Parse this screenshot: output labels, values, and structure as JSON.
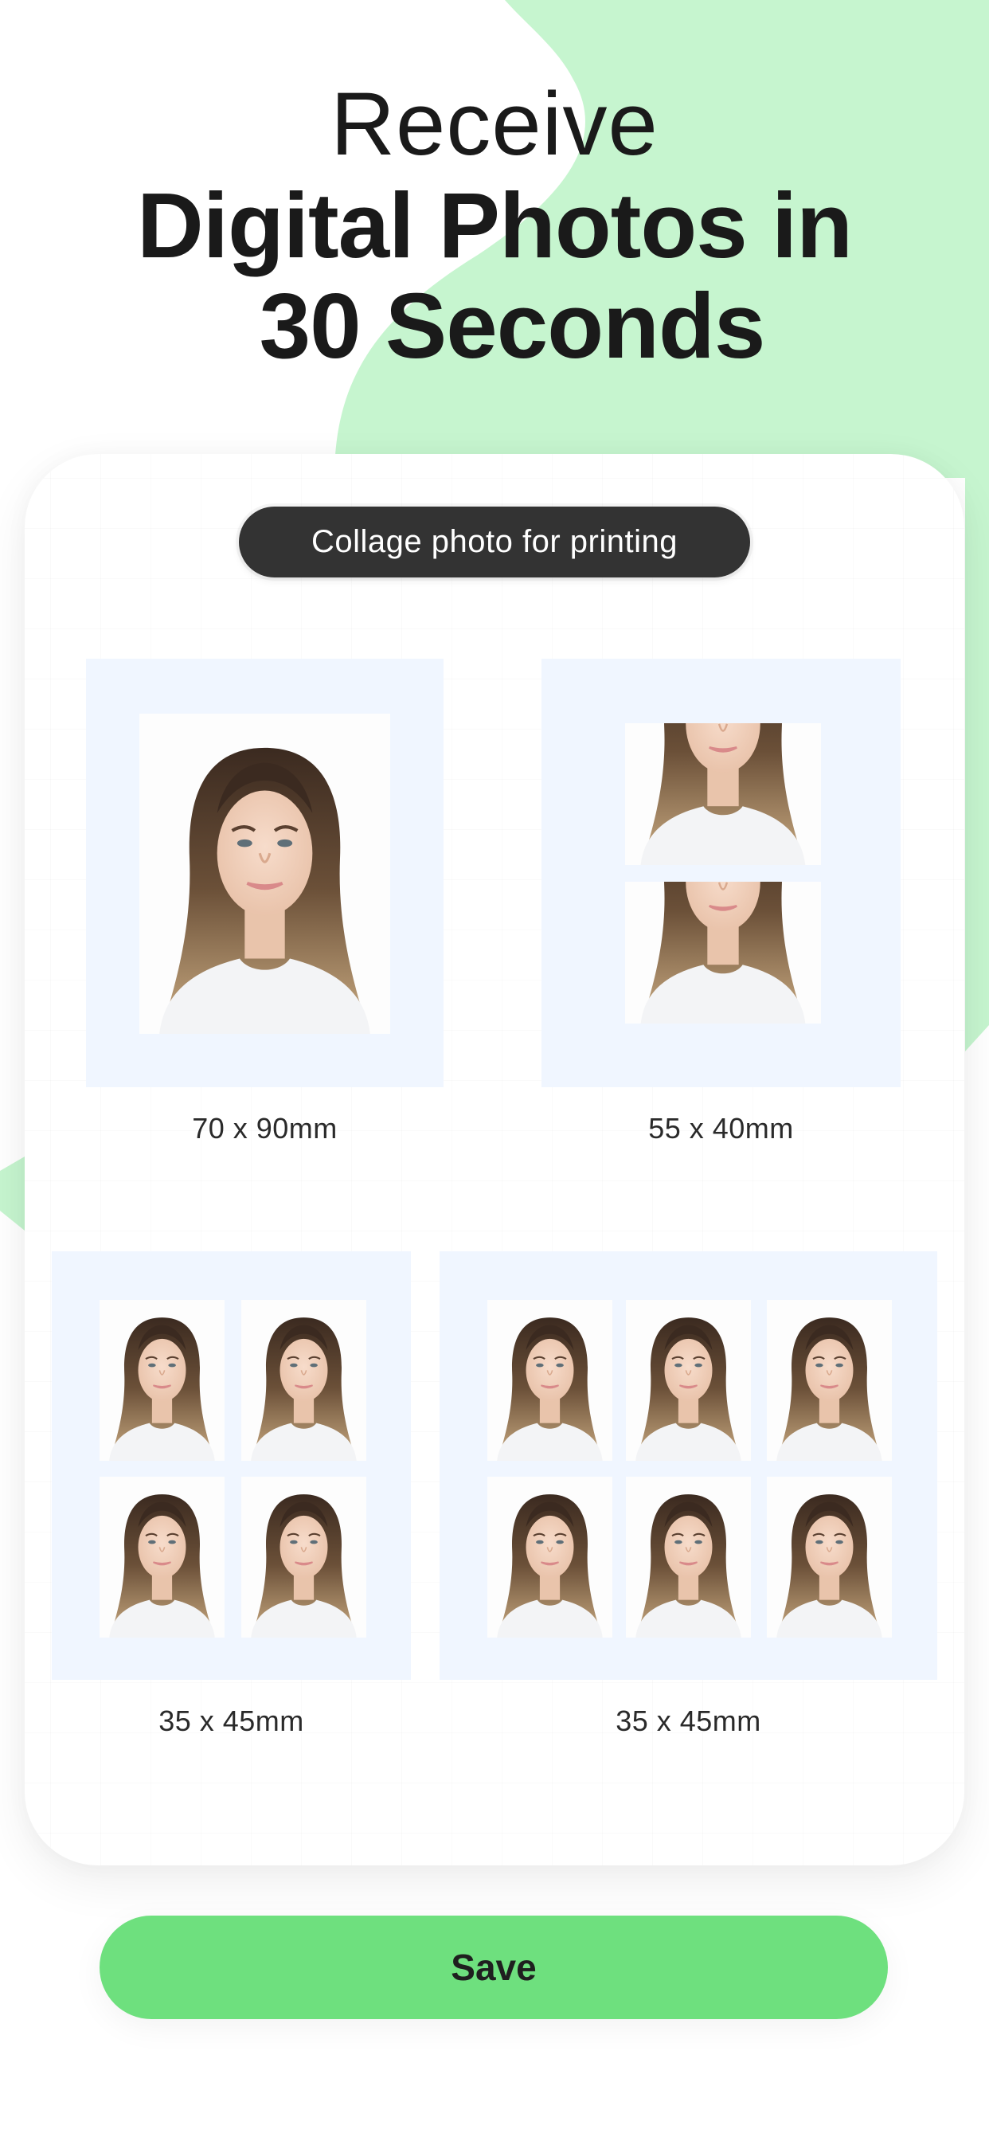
{
  "headline": {
    "line1": "Receive",
    "line2": "Digital Photos in",
    "line3": "30 Seconds"
  },
  "card": {
    "badge": "Collage photo for printing",
    "layouts": [
      {
        "size_label": "70 x 90mm",
        "copies": 1,
        "columns": 1,
        "rows": 1
      },
      {
        "size_label": "55 x 40mm",
        "copies": 2,
        "columns": 1,
        "rows": 2
      },
      {
        "size_label": "35 x 45mm",
        "copies": 4,
        "columns": 2,
        "rows": 2
      },
      {
        "size_label": "35 x 45mm",
        "copies": 6,
        "columns": 3,
        "rows": 2
      }
    ]
  },
  "actions": {
    "save_label": "Save"
  },
  "colors": {
    "accent_green": "#6ee07e",
    "blob_green": "#c6f5cf",
    "badge_bg": "#333333",
    "frame_bg": "#f0f6ff",
    "text": "#1a1a1a"
  }
}
